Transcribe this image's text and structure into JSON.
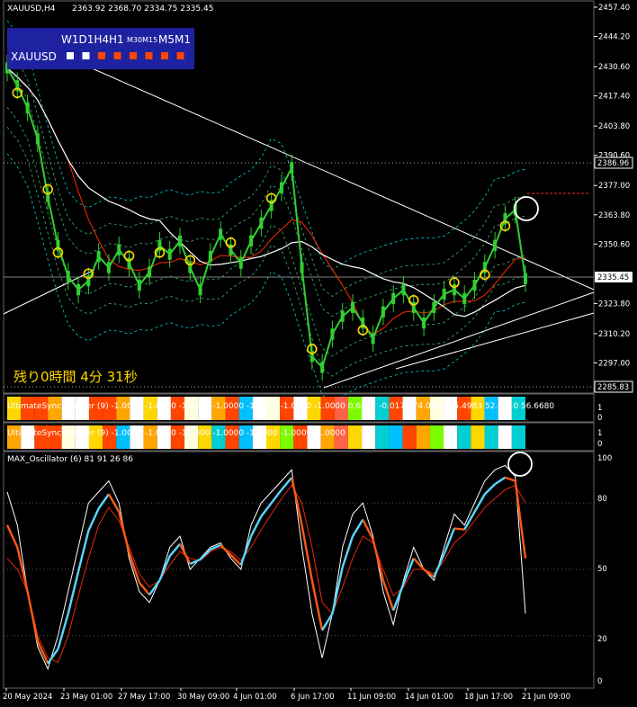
{
  "header": {
    "symbol": "XAUUSD,H4",
    "ohlc": "2363.92 2368.70 2334.75 2335.45"
  },
  "tf_panel": {
    "timeframes_big": "W1D1H4H1",
    "timeframes_small": "M30M15",
    "timeframes_tail": "M5M1",
    "symbol": "XAUUSD",
    "box_colors": [
      "#ffffff",
      "#ffffff",
      "#ff4500",
      "#ff4500",
      "#ff4500",
      "#ff4500",
      "#ff4500",
      "#ff4500"
    ]
  },
  "countdown": "残り0時間 4分 31秒",
  "price_axis": {
    "ticks": [
      "2457.40",
      "2444.20",
      "2430.60",
      "2417.40",
      "2403.80",
      "2390.60",
      "2377.00",
      "2363.80",
      "2350.60",
      "2323.80",
      "2310.20",
      "2297.00"
    ],
    "current_price": "2335.45",
    "upper_level": "2386.96",
    "lower_level": "2285.83"
  },
  "indicator1": {
    "label": "UltimateSynchronizer",
    "params": "(9) -1.0000 -1.0000 -1.0000 -1.0000 -1.0000 -1.0000 -1.0000 0.6362 -0.0171 74.0000 35.4983 52.9710 56.6680",
    "axis": [
      "1",
      "0"
    ]
  },
  "indicator2": {
    "label": "UltimateSynchronizer",
    "params": "(9) -1.0000 -1.0000 -1.0000 -1.0000 -1.0000 -1.0000 -1.0000",
    "axis": [
      "1",
      "0"
    ]
  },
  "oscillator": {
    "label": "MAX_Oscillator (6) 81 91 26 86",
    "axis": [
      "100",
      "80",
      "50",
      "20",
      "0"
    ]
  },
  "time_axis": [
    "20 May 2024",
    "23 May 01:00",
    "27 May 17:00",
    "30 May 09:00",
    "4 Jun 01:00",
    "6 Jun 17:00",
    "11 Jun 09:00",
    "14 Jun 01:00",
    "18 Jun 17:00",
    "21 Jun 09:00"
  ],
  "colors": {
    "up_candle": "#32cd32",
    "down_candle": "#32cd32",
    "ma_red": "#ff2a00",
    "ma_white": "#ffffff",
    "envelope": "#3cb371",
    "envelope_cyan": "#00ced1",
    "marker": "#ffd700",
    "osc_white": "#ffffff",
    "osc_cyan": "#5ad7ff",
    "osc_orange": "#ff5a14",
    "osc_red": "#e6280a"
  },
  "chart_data": {
    "type": "candlestick",
    "symbol": "XAUUSD",
    "timeframe": "H4",
    "x": [
      "20 May 2024",
      "23 May 01:00",
      "27 May 17:00",
      "30 May 09:00",
      "4 Jun 01:00",
      "6 Jun 17:00",
      "11 Jun 09:00",
      "14 Jun 01:00",
      "18 Jun 17:00",
      "21 Jun 09:00"
    ],
    "close": [
      2430,
      2422,
      2412,
      2398,
      2372,
      2350,
      2336,
      2330,
      2334,
      2345,
      2340,
      2348,
      2342,
      2332,
      2338,
      2350,
      2346,
      2352,
      2340,
      2330,
      2345,
      2355,
      2348,
      2342,
      2352,
      2360,
      2368,
      2376,
      2385,
      2340,
      2300,
      2295,
      2310,
      2318,
      2322,
      2315,
      2308,
      2320,
      2326,
      2330,
      2322,
      2315,
      2322,
      2328,
      2330,
      2326,
      2332,
      2340,
      2350,
      2362,
      2366,
      2335
    ],
    "ylim": [
      2285.83,
      2457.4
    ],
    "current_price": 2335.45,
    "indicator_ranges": {
      "synchronizer": [
        0,
        1
      ],
      "oscillator": [
        0,
        100
      ]
    },
    "oscillator_levels": [
      100,
      80,
      50,
      20,
      0
    ],
    "oscillator_white": [
      85,
      70,
      40,
      15,
      5,
      20,
      40,
      60,
      80,
      85,
      90,
      80,
      55,
      40,
      35,
      45,
      60,
      65,
      50,
      55,
      60,
      62,
      55,
      50,
      70,
      80,
      85,
      90,
      95,
      60,
      30,
      10,
      30,
      60,
      75,
      80,
      65,
      40,
      25,
      45,
      60,
      50,
      45,
      60,
      75,
      70,
      80,
      90,
      95,
      97,
      92,
      30
    ],
    "oscillator_red": [
      55,
      50,
      40,
      20,
      10,
      8,
      20,
      38,
      55,
      70,
      78,
      72,
      60,
      48,
      42,
      45,
      52,
      58,
      55,
      54,
      58,
      60,
      58,
      54,
      60,
      68,
      75,
      82,
      88,
      80,
      60,
      35,
      30,
      42,
      55,
      65,
      62,
      50,
      38,
      42,
      50,
      50,
      48,
      54,
      62,
      66,
      72,
      78,
      82,
      86,
      88,
      80
    ]
  }
}
